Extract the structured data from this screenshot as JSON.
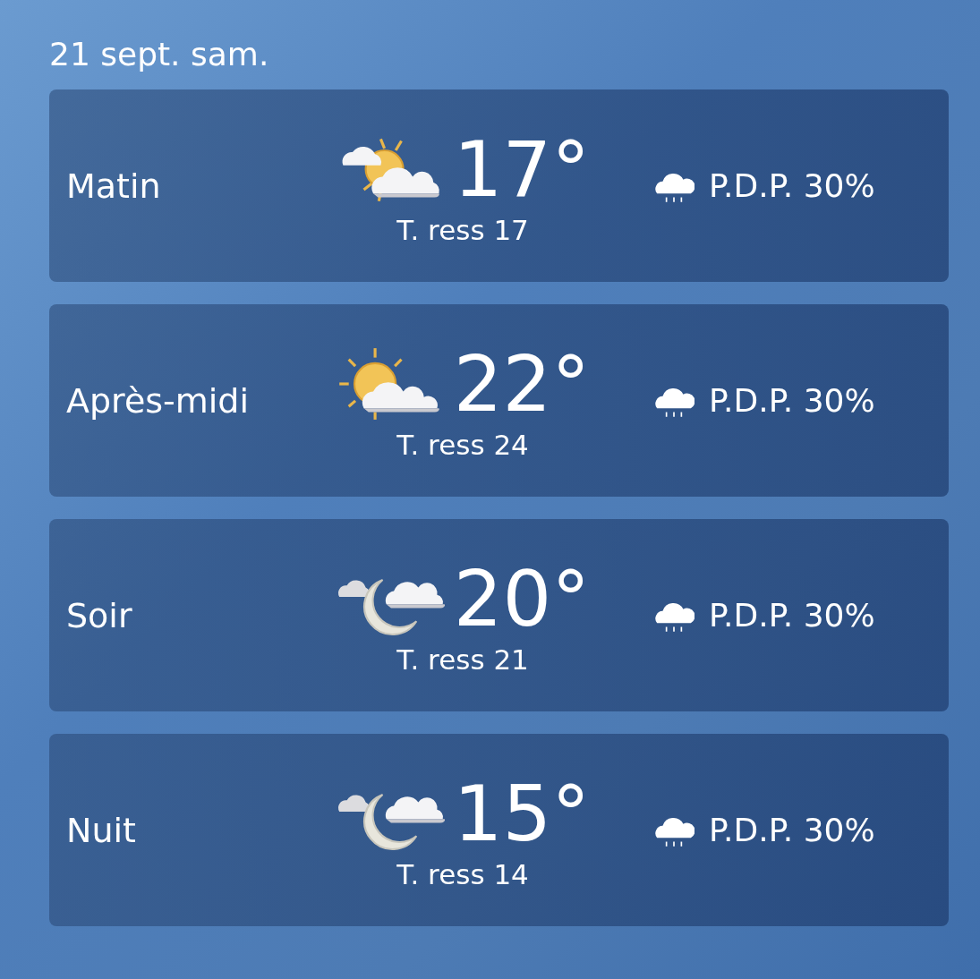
{
  "date": "21 sept. sam.",
  "periods": [
    {
      "name": "Matin",
      "kind": "sun-clouds",
      "temperature": "17°",
      "feels_like": "T. ress 17",
      "precipitation": "P.D.P. 30%"
    },
    {
      "name": "Après-midi",
      "kind": "sun-cloud",
      "temperature": "22°",
      "feels_like": "T. ress 24",
      "precipitation": "P.D.P. 30%"
    },
    {
      "name": "Soir",
      "kind": "moon-clouds",
      "temperature": "20°",
      "feels_like": "T. ress 21",
      "precipitation": "P.D.P. 30%"
    },
    {
      "name": "Nuit",
      "kind": "moon-clouds",
      "temperature": "15°",
      "feels_like": "T. ress 14",
      "precipitation": "P.D.P. 30%"
    }
  ]
}
